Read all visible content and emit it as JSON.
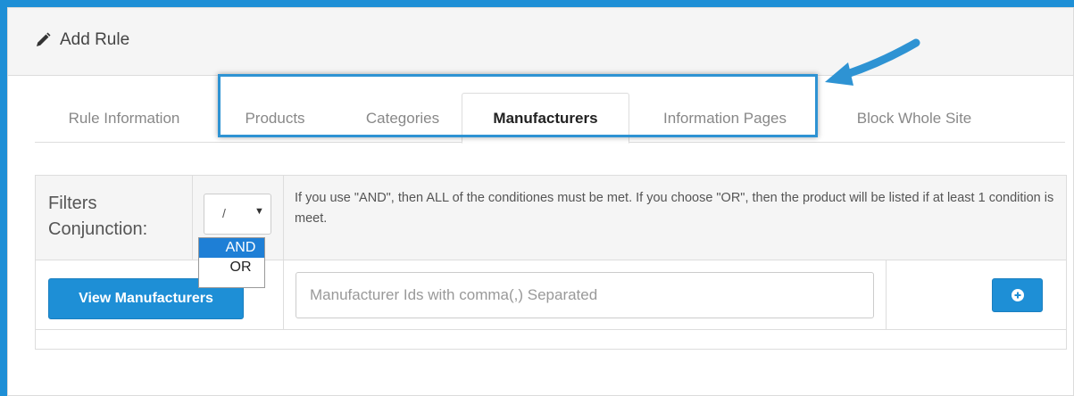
{
  "header": {
    "title": "Add Rule",
    "icon": "pencil-icon"
  },
  "tabs": [
    {
      "label": "Rule Information",
      "active": false
    },
    {
      "label": "Products",
      "active": false
    },
    {
      "label": "Categories",
      "active": false
    },
    {
      "label": "Manufacturers",
      "active": true
    },
    {
      "label": "Information Pages",
      "active": false
    },
    {
      "label": "Block Whole Site",
      "active": false
    }
  ],
  "filters": {
    "label_line1": "Filters",
    "label_line2": "Conjunction:",
    "select_value": "/",
    "options": [
      "AND",
      "OR"
    ],
    "selected_option": "AND",
    "help_text": "If you use \"AND\", then ALL of the conditiones must be met. If you choose \"OR\", then the product will be listed if at least 1 condition is meet."
  },
  "manufacturers": {
    "view_button_label": "View Manufacturers",
    "ids_placeholder": "Manufacturer Ids with comma(,) Separated",
    "ids_value": "",
    "add_icon": "plus-circle-icon"
  },
  "colors": {
    "accent": "#1e8fd6",
    "highlight": "#2e93d3",
    "dropdown_selected": "#1e7fd6"
  }
}
